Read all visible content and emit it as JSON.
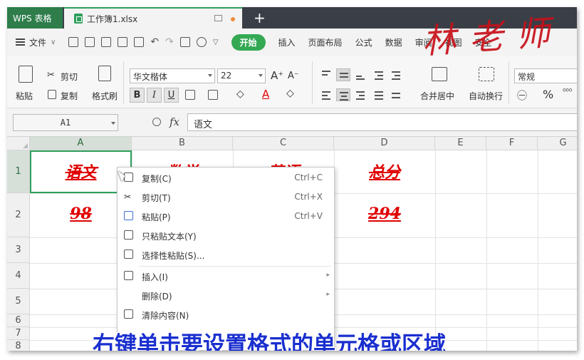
{
  "tabs": {
    "app": "WPS 表格",
    "document": "工作簿1.xlsx",
    "add": "+"
  },
  "menu": {
    "file": "文件",
    "start": "开始",
    "items": [
      "插入",
      "页面布局",
      "公式",
      "数据",
      "审阅",
      "视图",
      "安全"
    ]
  },
  "ribbon": {
    "paste": "粘贴",
    "cut": "剪切",
    "copy": "复制",
    "format_painter": "格式刷",
    "font_name": "华文楷体",
    "font_size": "22",
    "grow_font": "A⁺",
    "shrink_font": "A⁻",
    "bold": "B",
    "italic": "I",
    "underline": "U",
    "merge_center": "合并居中",
    "auto_wrap": "自动换行",
    "number_format": "常规",
    "percent": "%"
  },
  "formula_bar": {
    "cell_ref": "A1",
    "fx": "fx",
    "value": "语文"
  },
  "columns": [
    "A",
    "B",
    "C",
    "D",
    "E",
    "F",
    "G"
  ],
  "rows": [
    "1",
    "2",
    "3",
    "4",
    "5",
    "6",
    "7",
    "8"
  ],
  "cells": {
    "A1": "语文",
    "B1": "数学",
    "C1": "英语",
    "D1": "总分",
    "A2": "98",
    "D2": "294"
  },
  "context_menu": {
    "items": [
      {
        "label": "复制(C)",
        "shortcut": "Ctrl+C"
      },
      {
        "label": "剪切(T)",
        "shortcut": "Ctrl+X"
      },
      {
        "label": "粘贴(P)",
        "shortcut": "Ctrl+V"
      },
      {
        "label": "只粘贴文本(Y)",
        "shortcut": ""
      },
      {
        "label": "选择性粘贴(S)...",
        "shortcut": ""
      },
      {
        "label": "插入(I)",
        "shortcut": ""
      },
      {
        "label": "删除(D)",
        "shortcut": ""
      },
      {
        "label": "清除内容(N)",
        "shortcut": ""
      }
    ]
  },
  "watermark": "林老师",
  "subtitle": "右键单击要设置格式的单元格或区域",
  "colors": {
    "accent_green": "#2e9f5c",
    "cell_text_red": "#e00000",
    "subtitle_blue": "#1a2fcf",
    "watermark_red": "#c8101a"
  }
}
